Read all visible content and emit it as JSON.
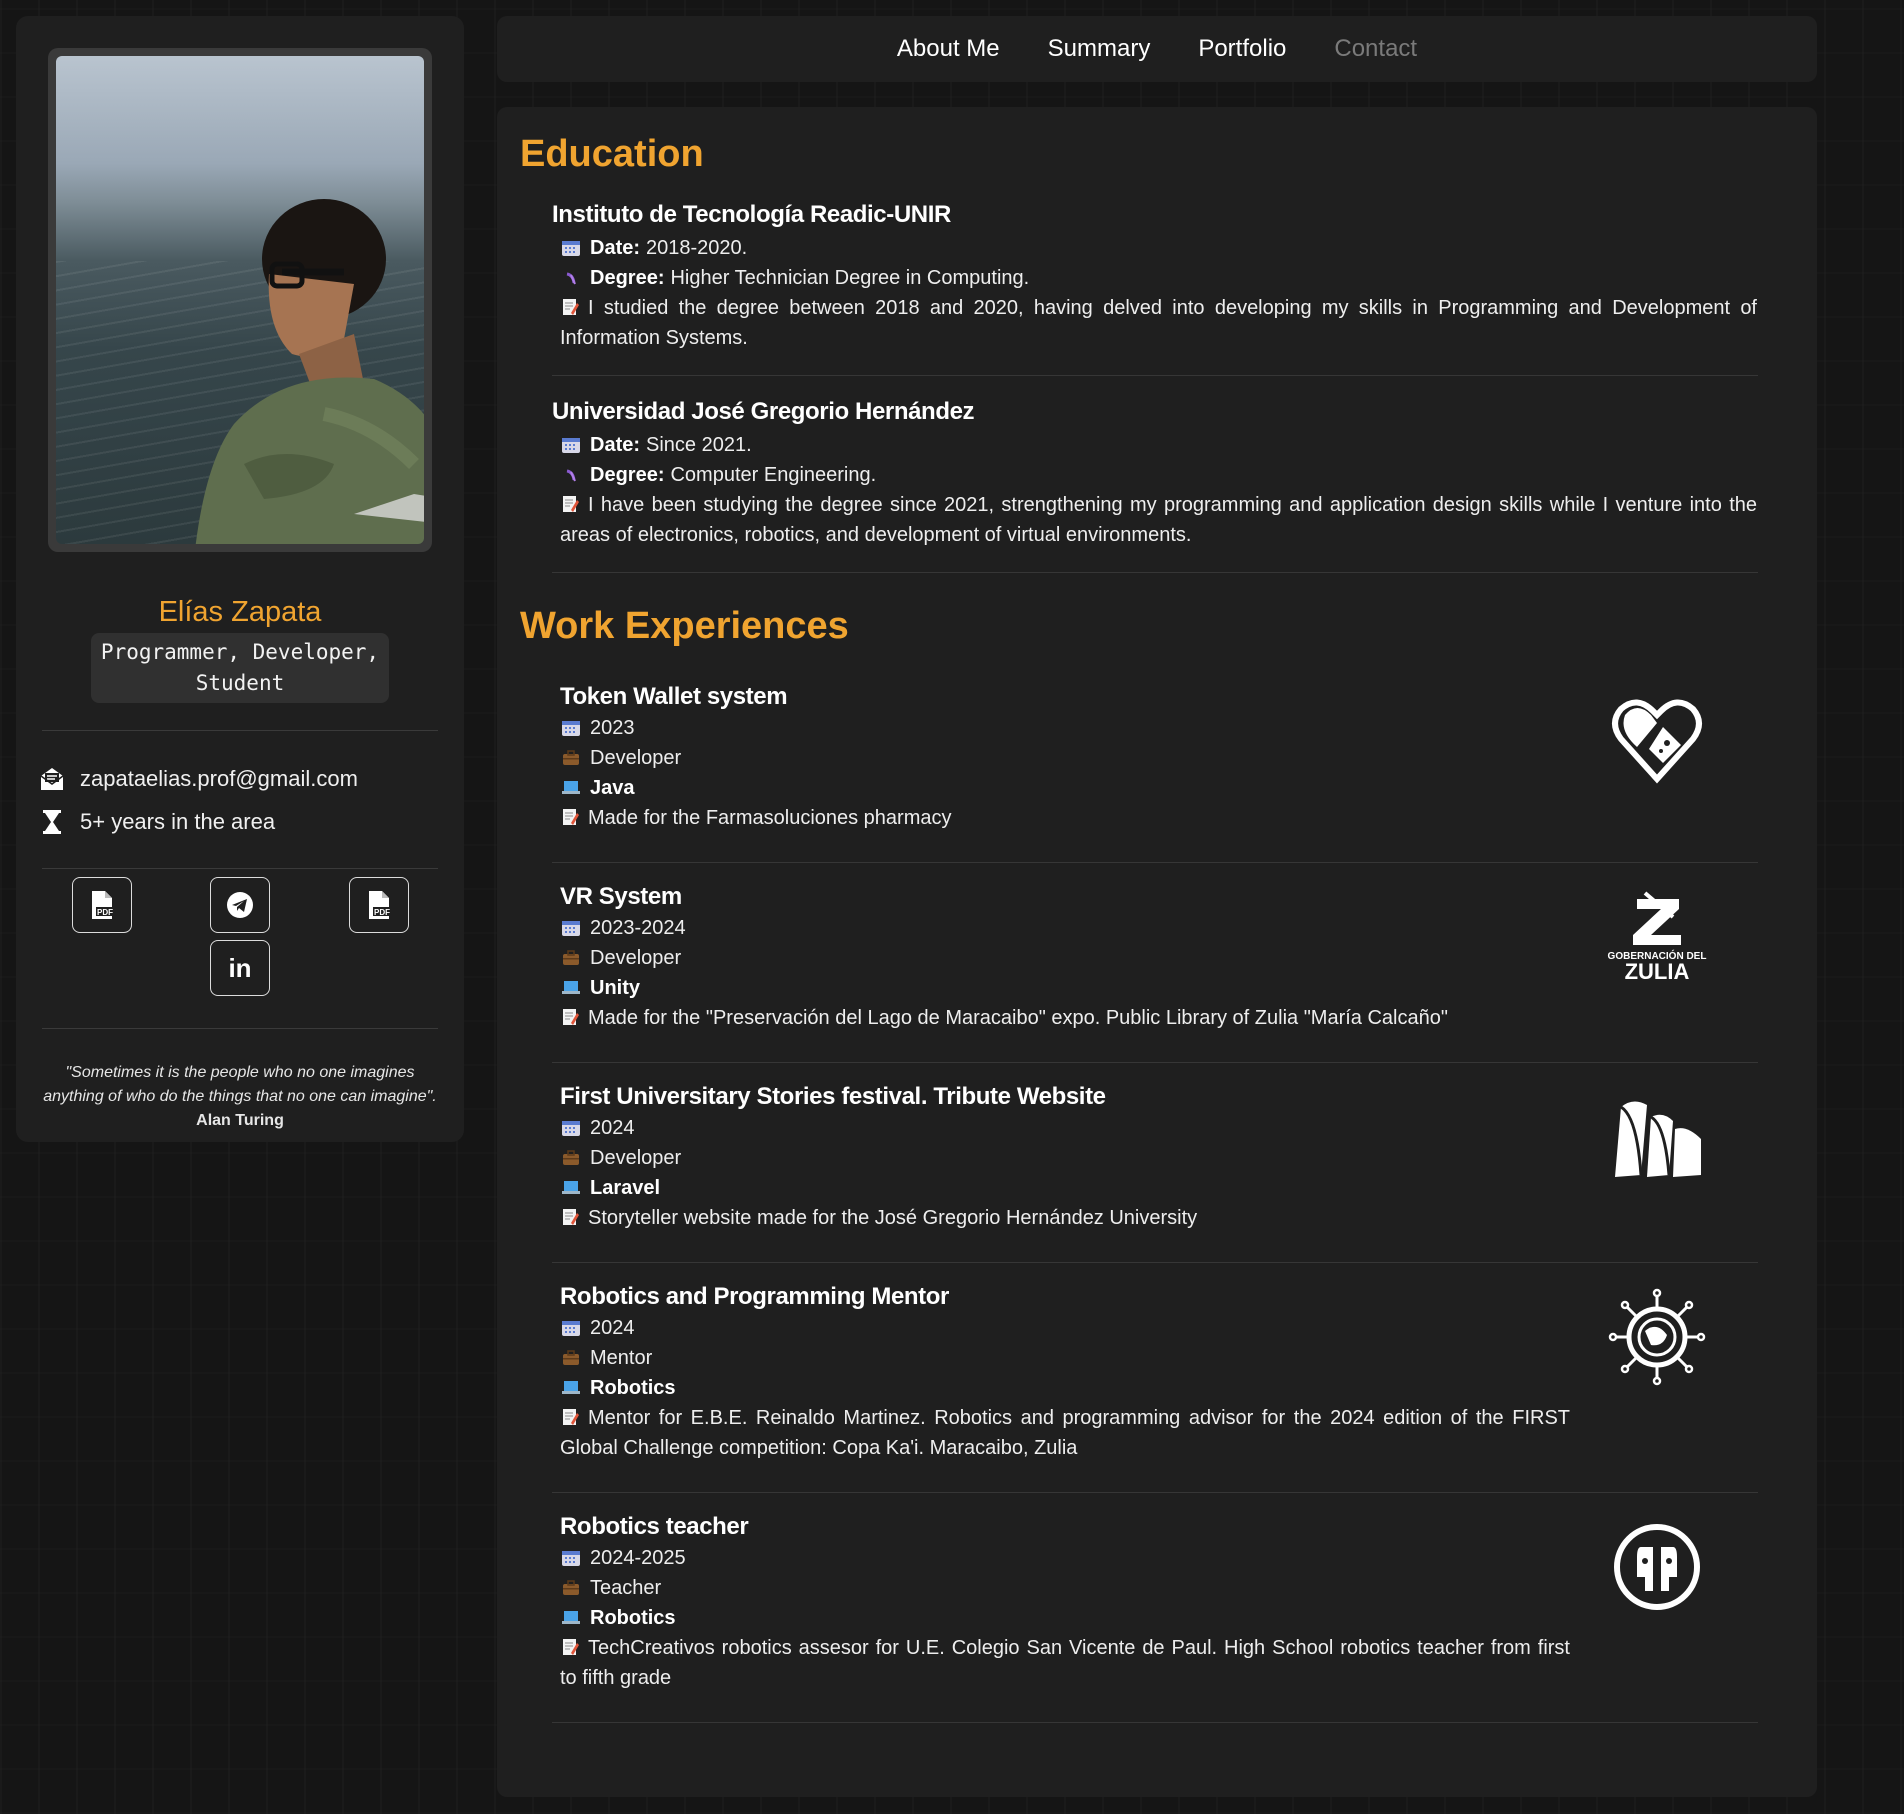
{
  "nav": {
    "items": [
      "About Me",
      "Summary",
      "Portfolio",
      "Contact"
    ]
  },
  "profile": {
    "name": "Elías Zapata",
    "role_line1": "Programmer, Developer,",
    "role_line2": "Student",
    "email": "zapataelias.prof@gmail.com",
    "experience": "5+ years in the area",
    "social": {
      "pdf_label": "PDF",
      "linkedin_label": "in"
    },
    "quote_text": "\"Sometimes it is the people who no one imagines anything of who do the things that no one can imagine\".",
    "quote_author": "Alan Turing"
  },
  "education": {
    "title": "Education",
    "date_label": "Date:",
    "degree_label": "Degree:",
    "items": [
      {
        "school": "Instituto de Tecnología Readic-UNIR",
        "date": "2018-2020.",
        "degree": "Higher Technician Degree in Computing.",
        "description": "I studied the degree between 2018 and 2020, having delved into developing my skills in Programming and Development of Information Systems."
      },
      {
        "school": "Universidad José Gregorio Hernández",
        "date": "Since 2021.",
        "degree": "Computer Engineering.",
        "description": "I have been studying the degree since 2021, strengthening my programming and application design skills while I venture into the areas of electronics, robotics, and development of virtual environments."
      }
    ]
  },
  "work": {
    "title": "Work Experiences",
    "items": [
      {
        "title": "Token Wallet system",
        "date": "2023",
        "role": "Developer",
        "tech": "Java",
        "description": "Made for the Farmasoluciones pharmacy",
        "logo": "heart-pill-logo"
      },
      {
        "title": "VR System",
        "date": "2023-2024",
        "role": "Developer",
        "tech": "Unity",
        "description": "Made for the \"Preservación del Lago de Maracaibo\" expo. Public Library of Zulia \"María Calcaño\"",
        "logo": "gobernacion-zulia-logo",
        "logo_text_small": "GOBERNACIÓN DEL",
        "logo_text_big": "ZULIA"
      },
      {
        "title": "First Universitary Stories festival. Tribute Website",
        "date": "2024",
        "role": "Developer",
        "tech": "Laravel",
        "description": "Storyteller website made for the José Gregorio Hernández University",
        "logo": "book-pages-logo"
      },
      {
        "title": "Robotics and Programming Mentor",
        "date": "2024",
        "role": "Mentor",
        "tech": "Robotics",
        "description": "Mentor for E.B.E. Reinaldo Martinez. Robotics and programming advisor for the 2024 edition of the FIRST Global Challenge competition: Copa Ka'i. Maracaibo, Zulia",
        "logo": "robotic-globe-logo"
      },
      {
        "title": "Robotics teacher",
        "date": "2024-2025",
        "role": "Teacher",
        "tech": "Robotics",
        "description": "TechCreativos robotics assesor for U.E. Colegio San Vicente de Paul. High School robotics teacher from first to fifth grade",
        "logo": "techcreativos-logo"
      }
    ]
  },
  "colors": {
    "accent": "#f0a430",
    "panel": "#1f1f1f",
    "background": "#151515"
  }
}
